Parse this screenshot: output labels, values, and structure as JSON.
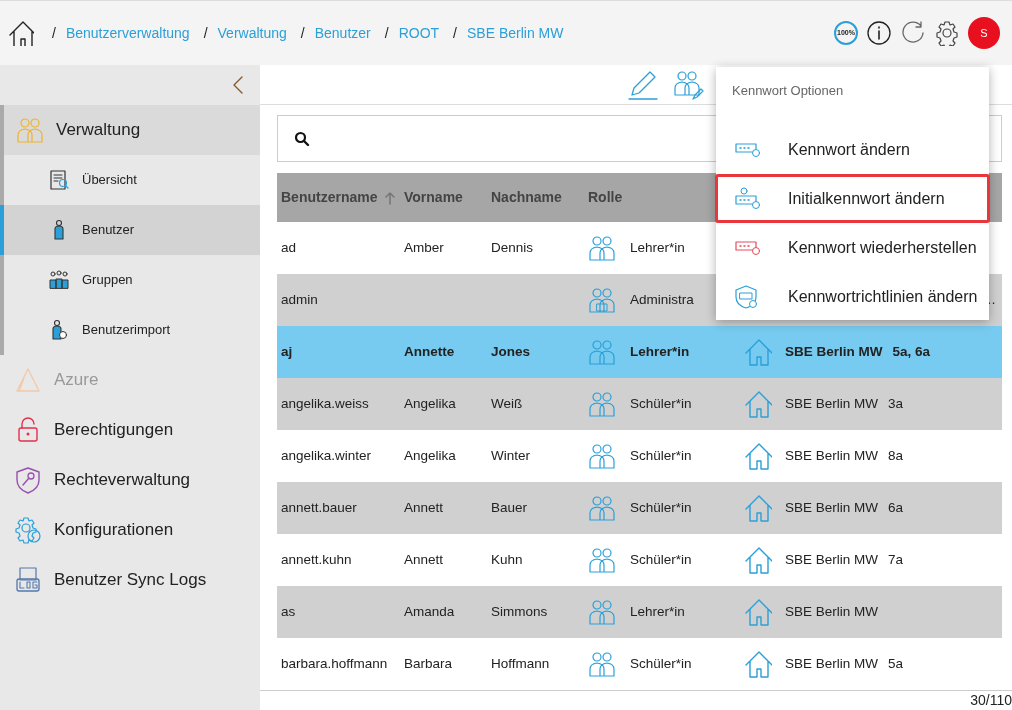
{
  "breadcrumbs": [
    {
      "separator": "/",
      "label": "Benutzerverwaltung"
    },
    {
      "separator": "/",
      "label": "Verwaltung"
    },
    {
      "separator": "/",
      "label": "Benutzer"
    },
    {
      "separator": "/",
      "label": "ROOT"
    },
    {
      "separator": "/",
      "label": "SBE Berlin MW"
    }
  ],
  "header": {
    "zoom": "100%",
    "avatar": "S"
  },
  "sidebar": {
    "items": [
      {
        "label": "Verwaltung",
        "kind": "admin",
        "expanded": true,
        "disabled": false,
        "children": [
          {
            "label": "Übersicht",
            "kind": "overview",
            "selected": false
          },
          {
            "label": "Benutzer",
            "kind": "user",
            "selected": true
          },
          {
            "label": "Gruppen",
            "kind": "group",
            "selected": false
          },
          {
            "label": "Benutzerimport",
            "kind": "import",
            "selected": false
          }
        ]
      },
      {
        "label": "Azure",
        "kind": "azure",
        "expanded": false,
        "disabled": true
      },
      {
        "label": "Berechtigungen",
        "kind": "lock",
        "expanded": false,
        "disabled": false
      },
      {
        "label": "Rechteverwaltung",
        "kind": "shield",
        "expanded": false,
        "disabled": false
      },
      {
        "label": "Konfigurationen",
        "kind": "gear",
        "expanded": false,
        "disabled": false
      },
      {
        "label": "Benutzer Sync Logs",
        "kind": "log",
        "expanded": false,
        "disabled": false
      }
    ]
  },
  "table": {
    "columns": [
      {
        "label": "Benutzername",
        "sorted": true
      },
      {
        "label": "Vorname"
      },
      {
        "label": "Nachname"
      },
      {
        "label": "Rolle"
      }
    ],
    "rows": [
      {
        "username": "ad",
        "first": "Amber",
        "last": "Dennis",
        "role": "Lehrer*in",
        "kind": "teacher",
        "selected": false
      },
      {
        "username": "admin",
        "role": "Administra",
        "kind": "admin",
        "classes": "…",
        "selected": false
      },
      {
        "username": "aj",
        "first": "Annette",
        "last": "Jones",
        "role": "Lehrer*in",
        "kind": "teacher",
        "school": "SBE Berlin MW",
        "classes": "5a, 6a",
        "selected": true
      },
      {
        "username": "angelika.weiss",
        "first": "Angelika",
        "last": "Weiß",
        "role": "Schüler*in",
        "kind": "student",
        "school": "SBE Berlin MW",
        "classes": "3a",
        "selected": false
      },
      {
        "username": "angelika.winter",
        "first": "Angelika",
        "last": "Winter",
        "role": "Schüler*in",
        "kind": "student",
        "school": "SBE Berlin MW",
        "classes": "8a",
        "selected": false
      },
      {
        "username": "annett.bauer",
        "first": "Annett",
        "last": "Bauer",
        "role": "Schüler*in",
        "kind": "student",
        "school": "SBE Berlin MW",
        "classes": "6a",
        "selected": false
      },
      {
        "username": "annett.kuhn",
        "first": "Annett",
        "last": "Kuhn",
        "role": "Schüler*in",
        "kind": "student",
        "school": "SBE Berlin MW",
        "classes": "7a",
        "selected": false
      },
      {
        "username": "as",
        "first": "Amanda",
        "last": "Simmons",
        "role": "Lehrer*in",
        "kind": "teacher",
        "school": "SBE Berlin MW",
        "selected": false
      },
      {
        "username": "barbara.hoffmann",
        "first": "Barbara",
        "last": "Hoffmann",
        "role": "Schüler*in",
        "kind": "student",
        "school": "SBE Berlin MW",
        "classes": "5a",
        "selected": false
      }
    ],
    "count": "30/110"
  },
  "menu": {
    "title": "Kennwort Optionen",
    "items": [
      {
        "label": "Kennwort ändern",
        "kind": "change",
        "selected": false
      },
      {
        "label": "Initialkennwort ändern",
        "kind": "initial",
        "selected": true
      },
      {
        "label": "Kennwort wiederherstellen",
        "kind": "restore",
        "selected": false
      },
      {
        "label": "Kennwortrichtlinien ändern",
        "kind": "policy",
        "selected": false
      }
    ]
  }
}
